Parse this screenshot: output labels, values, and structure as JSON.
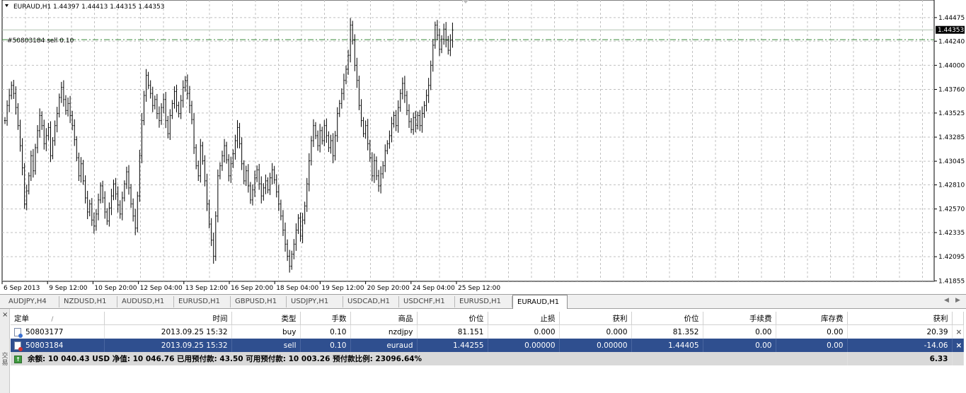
{
  "chart": {
    "header": "EURAUD,H1  1.44397 1.44413 1.44315 1.44353",
    "order_line_label": "#50803184 sell 0.10",
    "current_price": "1.44353",
    "colors": {
      "background": "#ffffff",
      "grid": "#c0c0c0",
      "candle": "#000000",
      "order_line": "#3a8a3a",
      "price_line": "#b0c4b0"
    }
  },
  "tabs": {
    "items": [
      "AUDJPY,H4",
      "NZDUSD,H1",
      "AUDUSD,H1",
      "EURUSD,H1",
      "GBPUSD,H1",
      "USDJPY,H1",
      "USDCAD,H1",
      "USDCHF,H1",
      "EURUSD,H1",
      "EURAUD,H1"
    ],
    "active": "EURAUD,H1",
    "nav_left": "◀",
    "nav_right": "▶"
  },
  "terminal": {
    "close_icon": "×",
    "side_label": "交易",
    "columns": [
      "定单",
      "/",
      "时间",
      "类型",
      "手数",
      "商品",
      "价位",
      "止损",
      "获利",
      "价位",
      "手续费",
      "库存费",
      "获利"
    ],
    "rows": [
      {
        "order": "50803177",
        "time": "2013.09.25 15:32",
        "type": "buy",
        "lots": "0.10",
        "symbol": "nzdjpy",
        "open_price": "81.151",
        "sl": "0.000",
        "tp": "0.000",
        "price": "81.352",
        "commission": "0.00",
        "swap": "0.00",
        "profit": "20.39",
        "close": "×"
      },
      {
        "order": "50803184",
        "time": "2013.09.25 15:32",
        "type": "sell",
        "lots": "0.10",
        "symbol": "euraud",
        "open_price": "1.44255",
        "sl": "0.00000",
        "tp": "0.00000",
        "price": "1.44405",
        "commission": "0.00",
        "swap": "0.00",
        "profit": "-14.06",
        "close": "×"
      }
    ],
    "summary": {
      "text": "余额: 10 040.43 USD  净值: 10 046.76  已用预付款: 43.50  可用预付款: 10 003.26  预付款比例: 23096.64%",
      "profit": "6.33"
    }
  },
  "chart_data": {
    "type": "ohlc",
    "title": "EURAUD,H1  1.44397 1.44413 1.44315 1.44353",
    "y_ticks": [
      "1.44475",
      "1.44240",
      "1.44000",
      "1.43760",
      "1.43525",
      "1.43285",
      "1.43045",
      "1.42810",
      "1.42570",
      "1.42335",
      "1.42095",
      "1.41855"
    ],
    "x_ticks": [
      "6 Sep 2013",
      "9 Sep 12:00",
      "10 Sep 20:00",
      "12 Sep 04:00",
      "13 Sep 12:00",
      "16 Sep 20:00",
      "18 Sep 04:00",
      "19 Sep 12:00",
      "20 Sep 20:00",
      "24 Sep 04:00",
      "25 Sep 12:00"
    ],
    "ylim": [
      1.4185,
      1.4465
    ],
    "order_line": 1.44255,
    "current_price": 1.44353,
    "closes": [
      1.4345,
      1.436,
      1.437,
      1.438,
      1.4372,
      1.4358,
      1.434,
      1.432,
      1.4298,
      1.4262,
      1.4275,
      1.429,
      1.431,
      1.4295,
      1.4318,
      1.4335,
      1.435,
      1.434,
      1.4322,
      1.433,
      1.4338,
      1.431,
      1.4325,
      1.434,
      1.4352,
      1.4368,
      1.4378,
      1.4366,
      1.4355,
      1.4362,
      1.435,
      1.434,
      1.4326,
      1.4308,
      1.429,
      1.4302,
      1.4285,
      1.4268,
      1.4254,
      1.4262,
      1.4246,
      1.424,
      1.4252,
      1.4266,
      1.428,
      1.4268,
      1.4254,
      1.4245,
      1.4258,
      1.427,
      1.4282,
      1.4272,
      1.4261,
      1.4252,
      1.4268,
      1.4282,
      1.4294,
      1.4278,
      1.4262,
      1.425,
      1.4238,
      1.427,
      1.431,
      1.4345,
      1.437,
      1.439,
      1.438,
      1.4372,
      1.436,
      1.4366,
      1.4352,
      1.4345,
      1.4358,
      1.4366,
      1.4345,
      1.4332,
      1.435,
      1.4362,
      1.4374,
      1.436,
      1.4352,
      1.4365,
      1.4378,
      1.4385,
      1.4372,
      1.436,
      1.4346,
      1.4318,
      1.43,
      1.429,
      1.432,
      1.4305,
      1.4285,
      1.4262,
      1.4242,
      1.4226,
      1.421,
      1.425,
      1.429,
      1.43,
      1.431,
      1.432,
      1.4306,
      1.429,
      1.4302,
      1.4312,
      1.4325,
      1.4338,
      1.4322,
      1.4302,
      1.4285,
      1.4295,
      1.428,
      1.4266,
      1.4276,
      1.4288,
      1.4296,
      1.4282,
      1.427,
      1.4278,
      1.4285,
      1.4276,
      1.4288,
      1.4296,
      1.4286,
      1.4274,
      1.4262,
      1.425,
      1.4236,
      1.4222,
      1.421,
      1.42,
      1.4212,
      1.4222,
      1.4236,
      1.4248,
      1.423,
      1.4246,
      1.426,
      1.4282,
      1.4305,
      1.4325,
      1.434,
      1.433,
      1.432,
      1.4335,
      1.4325,
      1.434,
      1.433,
      1.4318,
      1.4325,
      1.431,
      1.433,
      1.4352,
      1.4362,
      1.4372,
      1.4385,
      1.4396,
      1.441,
      1.444,
      1.4425,
      1.44,
      1.4385,
      1.436,
      1.4345,
      1.4332,
      1.434,
      1.4322,
      1.4308,
      1.429,
      1.4305,
      1.429,
      1.428,
      1.4292,
      1.43,
      1.4315,
      1.4322,
      1.433,
      1.4342,
      1.435,
      1.434,
      1.4358,
      1.4372,
      1.4382,
      1.437,
      1.4355,
      1.4344,
      1.4336,
      1.4348,
      1.434,
      1.435,
      1.434,
      1.4352,
      1.436,
      1.437,
      1.438,
      1.44,
      1.442,
      1.444,
      1.443,
      1.4416,
      1.4426,
      1.4436,
      1.4425,
      1.4415,
      1.4425,
      1.4435
    ]
  }
}
